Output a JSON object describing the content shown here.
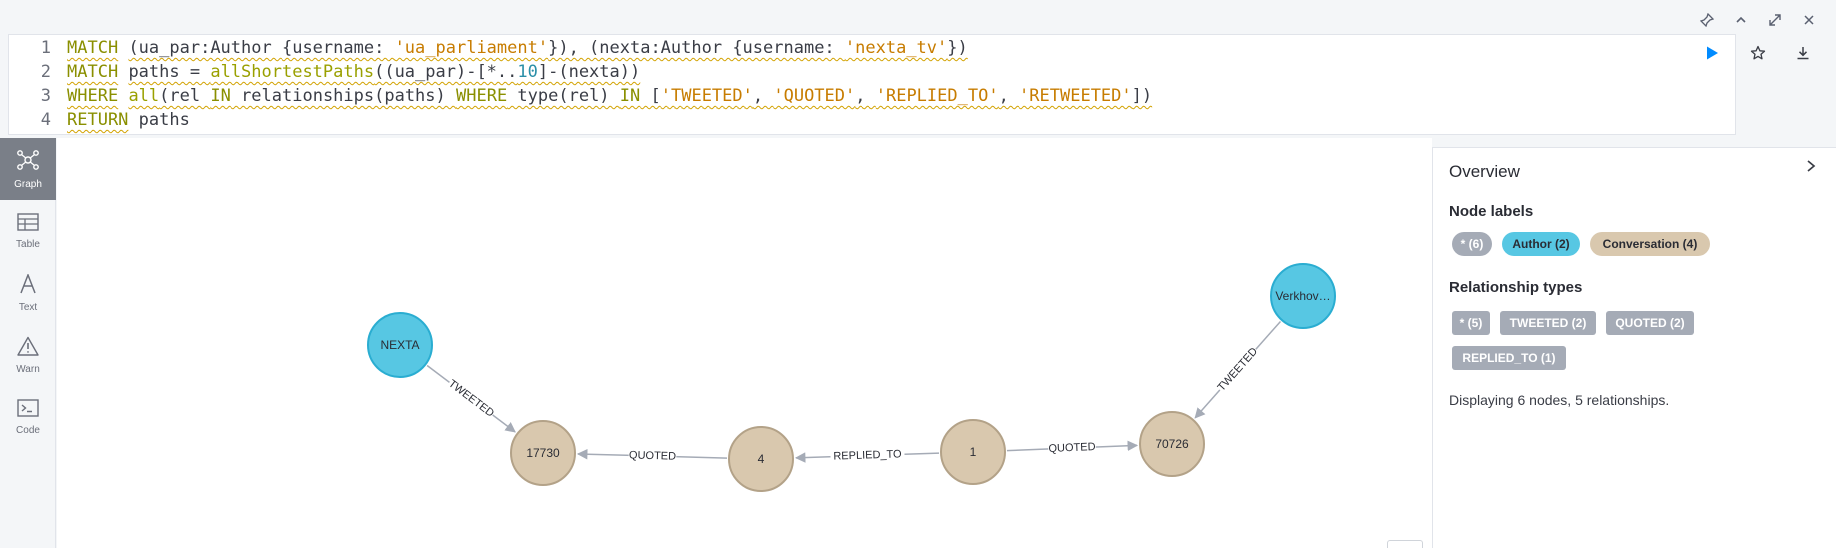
{
  "window_controls": [
    {
      "name": "pin-icon",
      "glyph": "⚲"
    },
    {
      "name": "collapse-up-icon",
      "glyph": "⌃"
    },
    {
      "name": "expand-icon",
      "glyph": "⤢"
    },
    {
      "name": "close-icon",
      "glyph": "✕"
    }
  ],
  "editor": {
    "line_numbers": [
      "1",
      "2",
      "3",
      "4"
    ]
  },
  "sidebar": {
    "tabs": [
      {
        "label": "Graph",
        "icon": "graph-icon",
        "active": true
      },
      {
        "label": "Table",
        "icon": "table-icon",
        "active": false
      },
      {
        "label": "Text",
        "icon": "text-icon",
        "active": false
      },
      {
        "label": "Warn",
        "icon": "warn-icon",
        "active": false
      },
      {
        "label": "Code",
        "icon": "code-icon",
        "active": false
      }
    ]
  },
  "graph": {
    "nodes": [
      {
        "id": "nexta",
        "label": "NEXTA",
        "type": "Author"
      },
      {
        "id": "verkhov",
        "label": "Verkhov…",
        "type": "Author"
      },
      {
        "id": "c17730",
        "label": "17730",
        "type": "Conversation"
      },
      {
        "id": "c4",
        "label": "4",
        "type": "Conversation"
      },
      {
        "id": "c1",
        "label": "1",
        "type": "Conversation"
      },
      {
        "id": "c70726",
        "label": "70726",
        "type": "Conversation"
      }
    ],
    "relationships": [
      {
        "from": "nexta",
        "to": "c17730",
        "label": "TWEETED"
      },
      {
        "from": "c4",
        "to": "c17730",
        "label": "QUOTED"
      },
      {
        "from": "c1",
        "to": "c4",
        "label": "REPLIED_TO"
      },
      {
        "from": "c1",
        "to": "c70726",
        "label": "QUOTED"
      },
      {
        "from": "verkhov",
        "to": "c70726",
        "label": "TWEETED"
      }
    ],
    "colors": {
      "Author": "#57c7e3",
      "Conversation": "#d9c8ae",
      "edge": "#a5abb6"
    }
  },
  "panel": {
    "title": "Overview",
    "node_labels_heading": "Node labels",
    "node_labels": [
      {
        "label": "* (6)",
        "color": "#a5abb6",
        "text_color": "#ffffff"
      },
      {
        "label": "Author (2)",
        "color": "#57c7e3",
        "text_color": "#2a2c34"
      },
      {
        "label": "Conversation (4)",
        "color": "#d9c8ae",
        "text_color": "#2a2c34"
      }
    ],
    "rel_types_heading": "Relationship types",
    "rel_types": [
      {
        "label": "* (5)"
      },
      {
        "label": "TWEETED (2)"
      },
      {
        "label": "QUOTED (2)"
      },
      {
        "label": "REPLIED_TO (1)"
      }
    ],
    "summary": "Displaying 6 nodes, 5 relationships."
  }
}
